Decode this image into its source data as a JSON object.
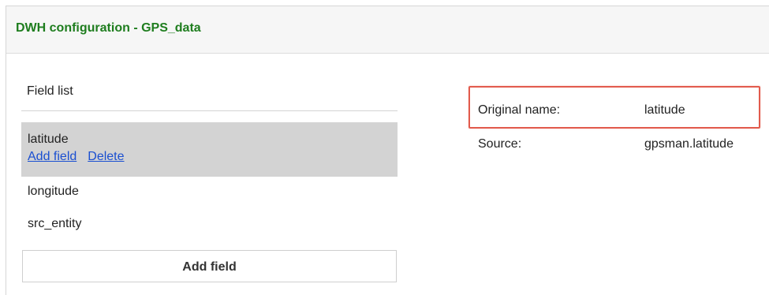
{
  "header": {
    "title": "DWH configuration - GPS_data",
    "title_color": "#1e7d1e"
  },
  "field_list": {
    "title": "Field list",
    "selected_index": 0,
    "items": [
      {
        "name": "latitude"
      },
      {
        "name": "longitude"
      },
      {
        "name": "src_entity"
      }
    ],
    "row_actions": {
      "add_label": "Add field",
      "delete_label": "Delete"
    },
    "add_button_label": "Add field"
  },
  "details": {
    "original_name_label": "Original name:",
    "original_name_value": "latitude",
    "source_label": "Source:",
    "source_value": "gpsman.latitude",
    "highlight_color": "#e25b4d"
  },
  "colors": {
    "link": "#1a4fd1",
    "selected_row_bg": "#d3d3d3"
  }
}
